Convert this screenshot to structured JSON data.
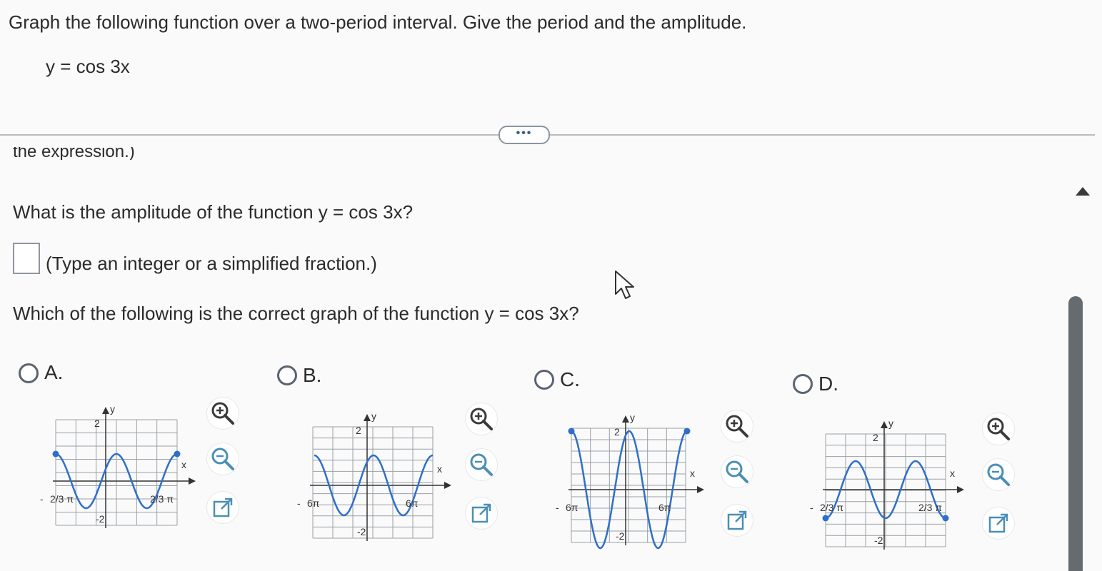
{
  "question": {
    "title": "Graph the following function over a two-period interval. Give the period and the amplitude.",
    "function": "y = cos 3x"
  },
  "more_button": "•••",
  "cut_text": "the expression.)",
  "amplitude": {
    "question": "What is the amplitude of the function y = cos 3x?",
    "input_value": "",
    "hint": "(Type an integer or a simplified fraction.)"
  },
  "graph_question": "Which of the following is the correct graph of the function y = cos 3x?",
  "options": [
    {
      "letter": "A.",
      "left_label": "2/3 π",
      "right_label": "2/3 π",
      "top_label": "2",
      "bottom_label": "-2",
      "y_axis": "y",
      "x_axis": "x",
      "left_minus": "-"
    },
    {
      "letter": "B.",
      "left_label": "6π",
      "right_label": "6π",
      "top_label": "2",
      "bottom_label": "-2",
      "y_axis": "y",
      "x_axis": "x",
      "left_minus": "-"
    },
    {
      "letter": "C.",
      "left_label": "6π",
      "right_label": "6π",
      "top_label": "2",
      "bottom_label": "-2",
      "y_axis": "y",
      "x_axis": "x",
      "left_minus": "-"
    },
    {
      "letter": "D.",
      "left_label": "2/3 π",
      "right_label": "2/3 π",
      "top_label": "2",
      "bottom_label": "-2",
      "y_axis": "y",
      "x_axis": "x",
      "left_minus": "-"
    }
  ],
  "colors": {
    "curve": "#2f6fc9",
    "grid": "#9aa0a6",
    "axis": "#333333"
  }
}
